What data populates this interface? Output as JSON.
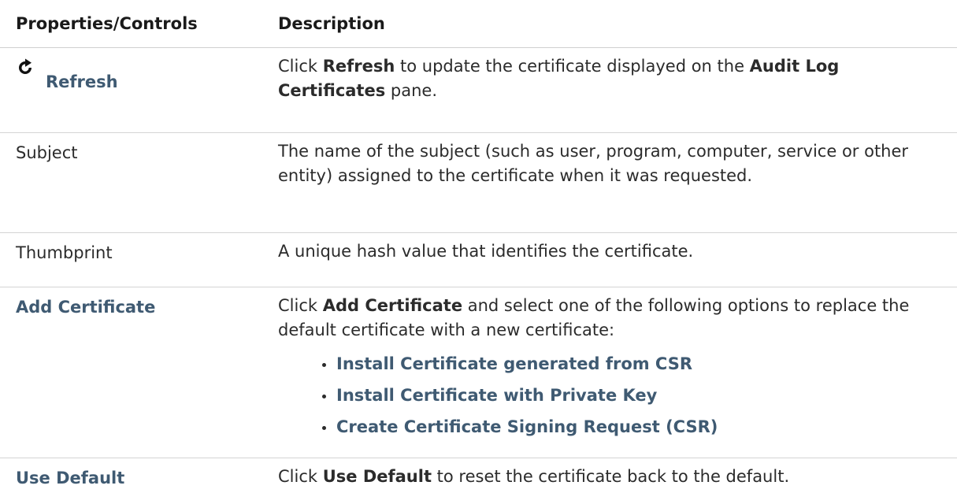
{
  "table": {
    "headers": {
      "col1": "Properties/Controls",
      "col2": "Description"
    },
    "rows": {
      "refresh": {
        "icon": "refresh-icon",
        "property": "Refresh",
        "desc_pre": "Click ",
        "desc_bold1": "Refresh",
        "desc_mid": " to update the certificate displayed on the ",
        "desc_bold2": "Audit Log Certificates",
        "desc_post": " pane."
      },
      "subject": {
        "property": "Subject",
        "description": "The name of the subject (such as user, program, computer, service or other entity) assigned to the certificate when it was requested."
      },
      "thumbprint": {
        "property": "Thumbprint",
        "description": "A unique hash value that identifies the certificate."
      },
      "add_certificate": {
        "property": "Add Certificate",
        "desc_pre": "Click ",
        "desc_bold": "Add Certificate",
        "desc_post": " and select one of the following options to replace the default certificate with a new certificate:",
        "options": [
          "Install Certificate generated from CSR",
          "Install Certificate with Private Key",
          "Create Certificate Signing Request (CSR)"
        ]
      },
      "use_default": {
        "property": "Use Default",
        "desc_pre": "Click ",
        "desc_bold": "Use Default",
        "desc_post": " to reset the certificate back to the default."
      }
    }
  },
  "colors": {
    "link": "#3f5a72",
    "text": "#2b2b2b",
    "rule": "#d4d4d4"
  }
}
